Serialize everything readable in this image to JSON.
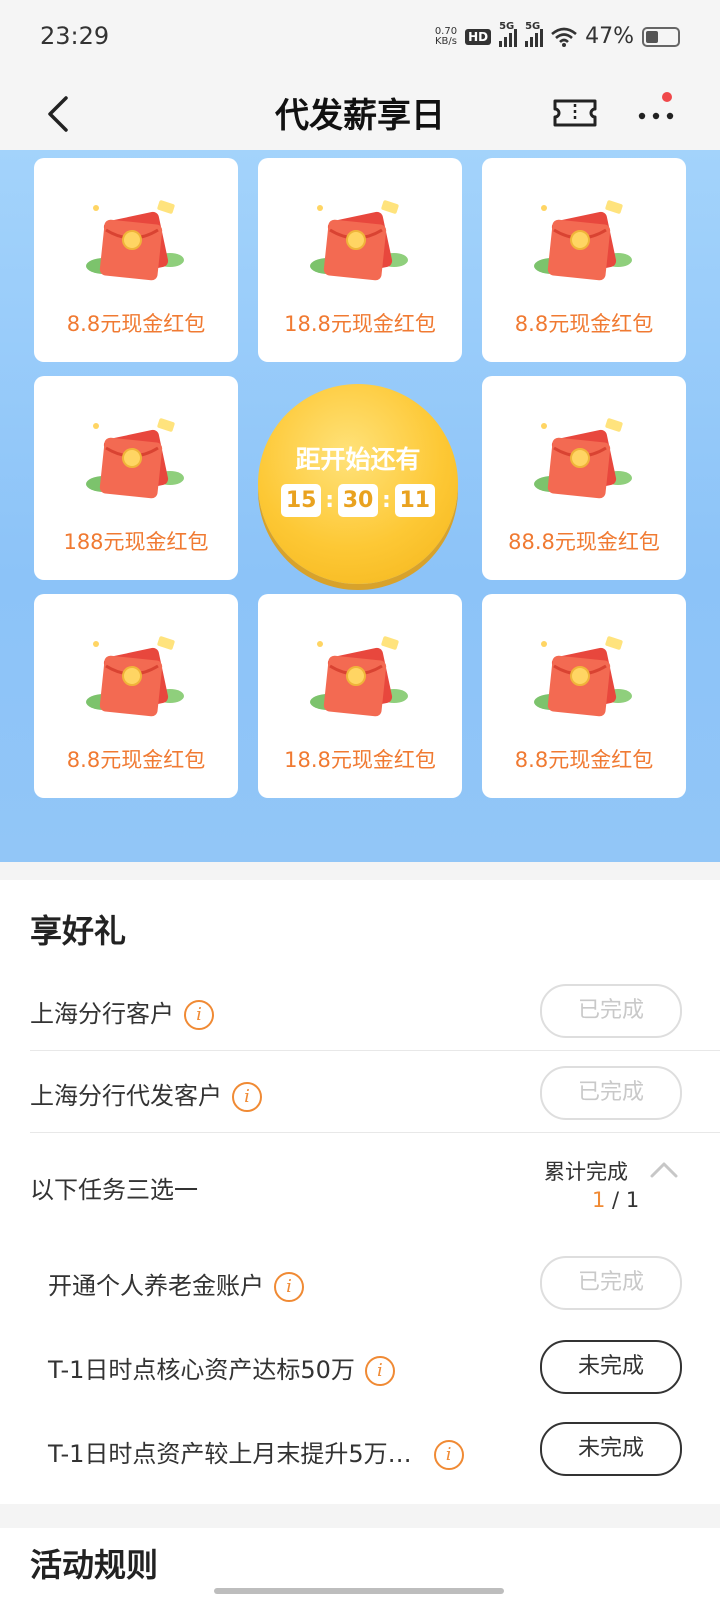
{
  "status_bar": {
    "time": "23:29",
    "net_speed_value": "0.70",
    "net_speed_unit": "KB/s",
    "hd_badge": "HD",
    "signal_label_1": "5G",
    "signal_label_2": "5G",
    "battery_percent": "47%",
    "battery_level": 0.47
  },
  "nav": {
    "title": "代发薪享日",
    "icons": [
      "back-icon",
      "ticket-icon",
      "more-icon"
    ]
  },
  "lottery": {
    "cards": [
      {
        "label": "8.8元现金红包"
      },
      {
        "label": "18.8元现金红包"
      },
      {
        "label": "8.8元现金红包"
      },
      {
        "label": "188元现金红包"
      },
      {
        "label": "88.8元现金红包"
      },
      {
        "label": "8.8元现金红包"
      },
      {
        "label": "18.8元现金红包"
      },
      {
        "label": "8.8元现金红包"
      }
    ],
    "countdown": {
      "title": "距开始还有",
      "hours": "15",
      "minutes": "30",
      "seconds": "11",
      "separator": ":"
    }
  },
  "gifts": {
    "title": "享好礼",
    "tasks": [
      {
        "label": "上海分行客户",
        "status": "已完成"
      },
      {
        "label": "上海分行代发客户",
        "status": "已完成"
      }
    ],
    "group": {
      "label": "以下任务三选一",
      "progress_label": "累计完成",
      "progress_current": "1",
      "progress_sep": " / ",
      "progress_total": "1",
      "items": [
        {
          "label": "开通个人养老金账户",
          "status": "已完成"
        },
        {
          "label": "T-1日时点核心资产达标50万",
          "status": "未完成"
        },
        {
          "label": "T-1日时点资产较上月末提升5万…",
          "status": "未完成"
        }
      ]
    }
  },
  "rules": {
    "title": "活动规则"
  },
  "colors": {
    "accent_orange": "#f07a32",
    "lottery_bg": "#9ccdf9",
    "countdown_gold": "#fdc835"
  }
}
